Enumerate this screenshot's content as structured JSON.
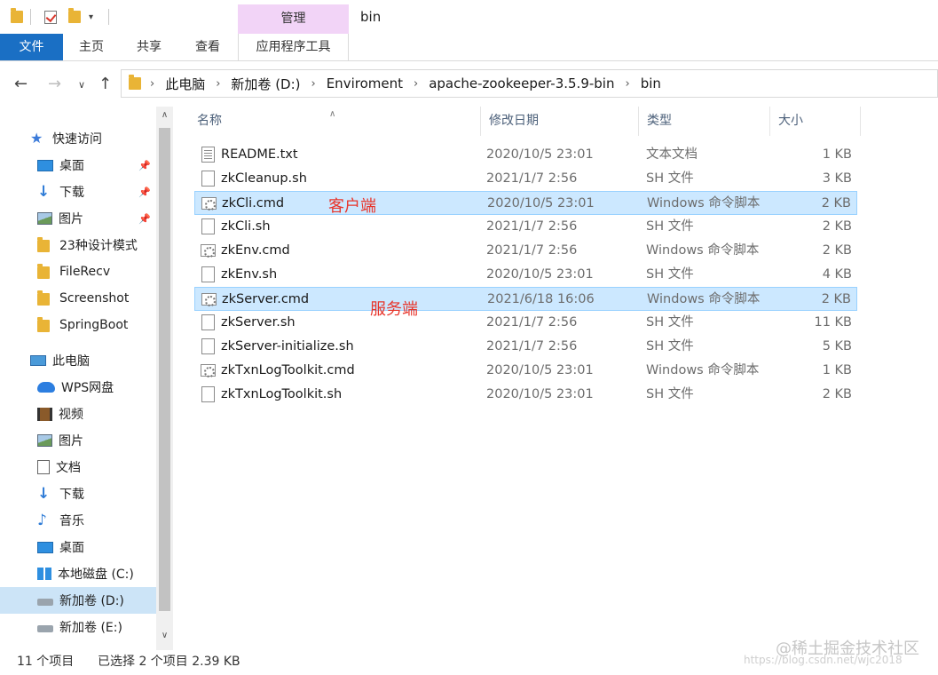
{
  "window": {
    "title": "bin",
    "manage_tab": "管理"
  },
  "ribbon": {
    "tabs": [
      {
        "label": "文件"
      },
      {
        "label": "主页"
      },
      {
        "label": "共享"
      },
      {
        "label": "查看"
      },
      {
        "label": "应用程序工具"
      }
    ]
  },
  "address": {
    "breadcrumbs": [
      "此电脑",
      "新加卷 (D:)",
      "Enviroment",
      "apache-zookeeper-3.5.9-bin",
      "bin"
    ]
  },
  "nav": {
    "items": [
      {
        "label": "快速访问",
        "icon": "star-icon"
      },
      {
        "label": "桌面",
        "icon": "desktop-icon",
        "pinned": true
      },
      {
        "label": "下载",
        "icon": "download-icon",
        "pinned": true
      },
      {
        "label": "图片",
        "icon": "pictures-icon",
        "pinned": true
      },
      {
        "label": "23种设计模式",
        "icon": "folder-icon"
      },
      {
        "label": "FileRecv",
        "icon": "folder-icon"
      },
      {
        "label": "Screenshot",
        "icon": "folder-icon"
      },
      {
        "label": "SpringBoot",
        "icon": "folder-icon"
      },
      {
        "label": "此电脑",
        "icon": "this-pc-icon"
      },
      {
        "label": "WPS网盘",
        "icon": "cloud-icon"
      },
      {
        "label": "视频",
        "icon": "video-icon"
      },
      {
        "label": "图片",
        "icon": "pictures-icon"
      },
      {
        "label": "文档",
        "icon": "documents-icon"
      },
      {
        "label": "下载",
        "icon": "download-icon"
      },
      {
        "label": "音乐",
        "icon": "music-icon"
      },
      {
        "label": "桌面",
        "icon": "desktop-icon"
      },
      {
        "label": "本地磁盘 (C:)",
        "icon": "windows-drive-icon"
      },
      {
        "label": "新加卷 (D:)",
        "icon": "drive-icon",
        "selected": true
      },
      {
        "label": "新加卷 (E:)",
        "icon": "drive-icon"
      }
    ]
  },
  "columns": {
    "name": "名称",
    "date": "修改日期",
    "type": "类型",
    "size": "大小"
  },
  "files": [
    {
      "name": "README.txt",
      "date": "2020/10/5 23:01",
      "type": "文本文档",
      "size": "1 KB",
      "icon": "text-file-icon"
    },
    {
      "name": "zkCleanup.sh",
      "date": "2021/1/7 2:56",
      "type": "SH 文件",
      "size": "3 KB",
      "icon": "file-icon"
    },
    {
      "name": "zkCli.cmd",
      "date": "2020/10/5 23:01",
      "type": "Windows 命令脚本",
      "size": "2 KB",
      "icon": "cmd-file-icon",
      "selected": true
    },
    {
      "name": "zkCli.sh",
      "date": "2021/1/7 2:56",
      "type": "SH 文件",
      "size": "2 KB",
      "icon": "file-icon"
    },
    {
      "name": "zkEnv.cmd",
      "date": "2021/1/7 2:56",
      "type": "Windows 命令脚本",
      "size": "2 KB",
      "icon": "cmd-file-icon"
    },
    {
      "name": "zkEnv.sh",
      "date": "2020/10/5 23:01",
      "type": "SH 文件",
      "size": "4 KB",
      "icon": "file-icon"
    },
    {
      "name": "zkServer.cmd",
      "date": "2021/6/18 16:06",
      "type": "Windows 命令脚本",
      "size": "2 KB",
      "icon": "cmd-file-icon",
      "selected": true
    },
    {
      "name": "zkServer.sh",
      "date": "2021/1/7 2:56",
      "type": "SH 文件",
      "size": "11 KB",
      "icon": "file-icon"
    },
    {
      "name": "zkServer-initialize.sh",
      "date": "2021/1/7 2:56",
      "type": "SH 文件",
      "size": "5 KB",
      "icon": "file-icon"
    },
    {
      "name": "zkTxnLogToolkit.cmd",
      "date": "2020/10/5 23:01",
      "type": "Windows 命令脚本",
      "size": "1 KB",
      "icon": "cmd-file-icon"
    },
    {
      "name": "zkTxnLogToolkit.sh",
      "date": "2020/10/5 23:01",
      "type": "SH 文件",
      "size": "2 KB",
      "icon": "file-icon"
    }
  ],
  "annotations": {
    "client": "客户端",
    "server": "服务端"
  },
  "status": {
    "count": "11 个项目",
    "selection": "已选择 2 个项目  2.39 KB"
  },
  "watermark": {
    "brand": "@稀土掘金技术社区",
    "url": "https://blog.csdn.net/wjc2018"
  },
  "colors": {
    "accent": "#1a6fc4",
    "manage_tab": "#f2d4f7",
    "selection": "#cce8ff",
    "annotation": "#e8352b"
  }
}
